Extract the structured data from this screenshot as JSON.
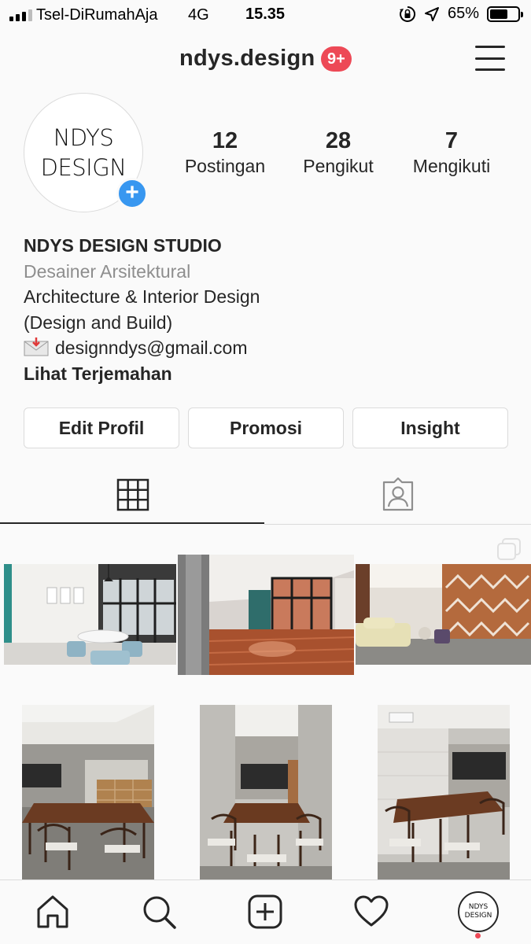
{
  "status_bar": {
    "carrier": "Tsel-DiRumahAja",
    "network": "4G",
    "time": "15.35",
    "battery": "65%",
    "battery_level": 0.65
  },
  "header": {
    "username": "ndys.design",
    "notification_badge": "9+"
  },
  "profile": {
    "avatar_text_line1": "NDYS",
    "avatar_text_line2": "DESIGN",
    "stats": [
      {
        "value": "12",
        "label": "Postingan"
      },
      {
        "value": "28",
        "label": "Pengikut"
      },
      {
        "value": "7",
        "label": "Mengikuti"
      }
    ],
    "bio": {
      "name": "NDYS DESIGN STUDIO",
      "category": "Desainer Arsitektural",
      "line1": "Architecture & Interior Design",
      "line2": "(Design and Build)",
      "email": "designndys@gmail.com",
      "translate": "Lihat Terjemahan"
    }
  },
  "buttons": {
    "edit_profile": "Edit Profil",
    "promote": "Promosi",
    "insight": "Insight"
  },
  "tabs": [
    {
      "icon": "grid-icon",
      "active": true
    },
    {
      "icon": "tagged-icon",
      "active": false
    }
  ],
  "bottom_nav": {
    "items": [
      "home-icon",
      "search-icon",
      "add-post-icon",
      "heart-icon",
      "profile-avatar"
    ],
    "avatar_line1": "NDYS",
    "avatar_line2": "DESIGN"
  },
  "colors": {
    "accent_blue": "#3897f0",
    "badge_red": "#ed4956",
    "text": "#262626",
    "muted": "#8e8e8e"
  }
}
